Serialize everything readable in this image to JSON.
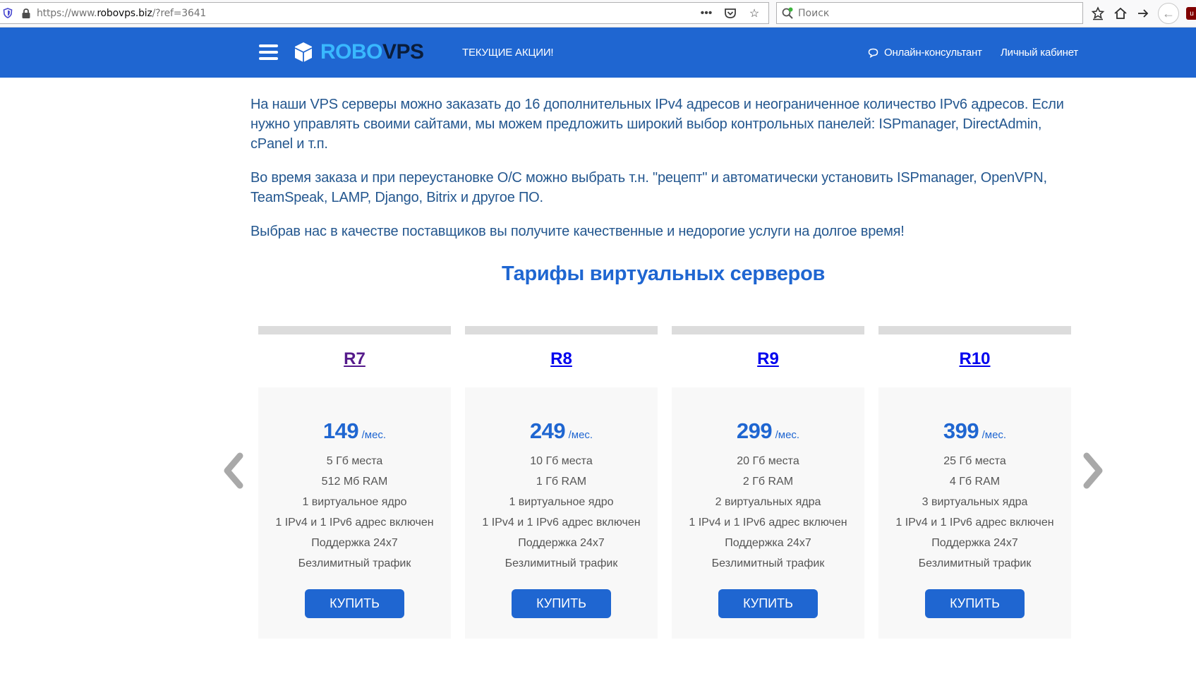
{
  "browser": {
    "url_prefix": "https://www.",
    "url_domain": "robovps.biz",
    "url_suffix": "/?ref=3641",
    "search_placeholder": "Поиск"
  },
  "header": {
    "logo_robo": "ROBO",
    "logo_vps": "VPS",
    "promo_label": "ТЕКУЩИЕ АКЦИИ!",
    "chat_label": "Онлайн-консультант",
    "account_label": "Личный кабинет",
    "brand_color": "#1f66d1"
  },
  "intro": {
    "p1": "На наши VPS серверы можно заказать до 16 дополнительных IPv4 адресов и неограниченное количество IPv6 адресов. Если нужно управлять своими сайтами, мы можем предложить широкий выбор контрольных панелей: ISPmanager, DirectAdmin, cPanel и т.п.",
    "p2": "Во время заказа и при переустановке О/С можно выбрать т.н. \"рецепт\" и автоматически установить ISPmanager, OpenVPN, TeamSpeak, LAMP, Django, Bitrix и другое ПО.",
    "p3": "Выбрав нас в качестве поставщиков вы получите качественные и недорогие услуги на долгое время!"
  },
  "section_title": "Тарифы виртуальных серверов",
  "plans": [
    {
      "name": "R7",
      "name_color": "#551a8b",
      "price": "149",
      "unit": "/мес.",
      "features": [
        "5 Гб места",
        "512 Мб RAM",
        "1 виртуальное ядро",
        "1 IPv4 и 1 IPv6 адрес включен",
        "Поддержка 24x7",
        "Безлимитный трафик"
      ],
      "buy": "КУПИТЬ"
    },
    {
      "name": "R8",
      "name_color": "#0000ee",
      "price": "249",
      "unit": "/мес.",
      "features": [
        "10 Гб места",
        "1 Гб RAM",
        "1 виртуальное ядро",
        "1 IPv4 и 1 IPv6 адрес включен",
        "Поддержка 24x7",
        "Безлимитный трафик"
      ],
      "buy": "КУПИТЬ"
    },
    {
      "name": "R9",
      "name_color": "#0000ee",
      "price": "299",
      "unit": "/мес.",
      "features": [
        "20 Гб места",
        "2 Гб RAM",
        "2 виртуальных ядра",
        "1 IPv4 и 1 IPv6 адрес включен",
        "Поддержка 24x7",
        "Безлимитный трафик"
      ],
      "buy": "КУПИТЬ"
    },
    {
      "name": "R10",
      "name_color": "#0000ee",
      "price": "399",
      "unit": "/мес.",
      "features": [
        "25 Гб места",
        "4 Гб RAM",
        "3 виртуальных ядра",
        "1 IPv4 и 1 IPv6 адрес включен",
        "Поддержка 24x7",
        "Безлимитный трафик"
      ],
      "buy": "КУПИТЬ"
    }
  ]
}
